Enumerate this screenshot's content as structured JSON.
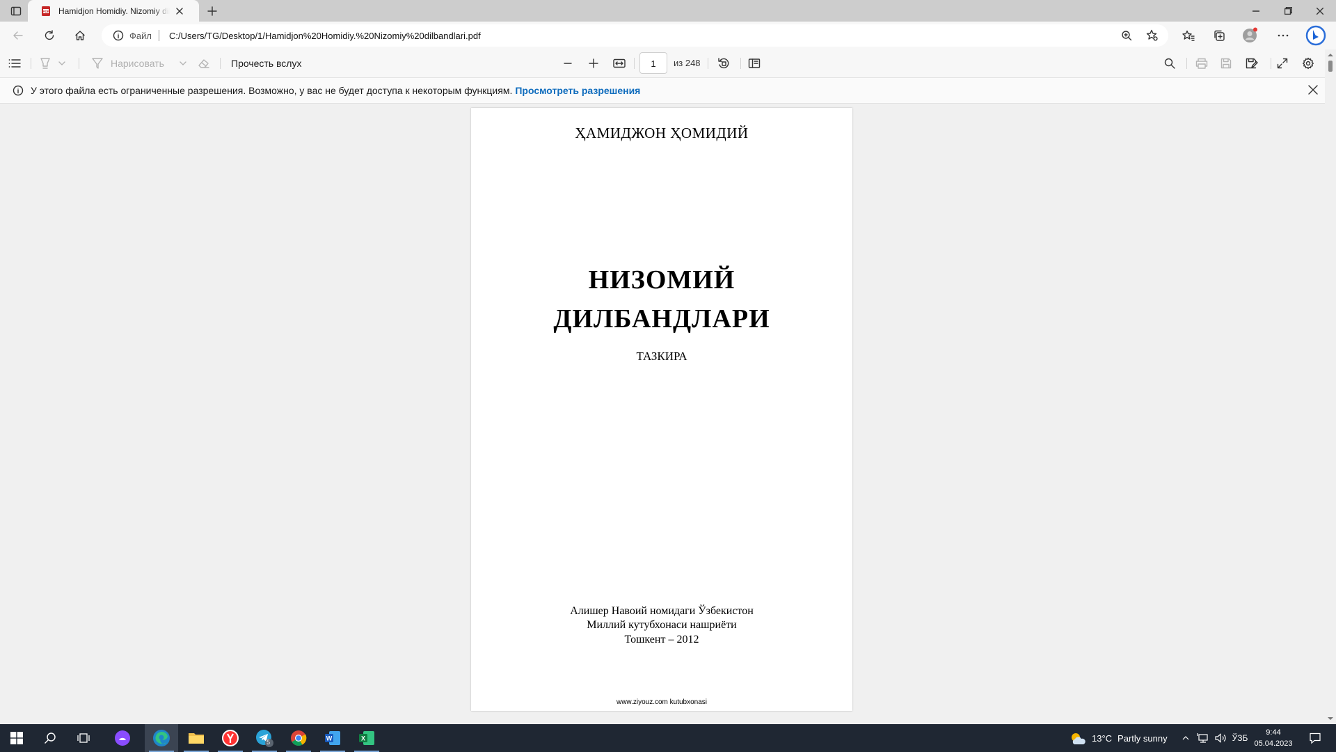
{
  "tab": {
    "title": "Hamidjon Homidiy. Nizomiy dilbandlari.pdf"
  },
  "address": {
    "scheme_label": "Файл",
    "url": "C:/Users/TG/Desktop/1/Hamidjon%20Homidiy.%20Nizomiy%20dilbandlari.pdf"
  },
  "toolbar": {
    "draw_label": "Нарисовать",
    "read_aloud_label": "Прочесть вслух",
    "page_current": "1",
    "page_total_label": "из 248"
  },
  "infobar": {
    "message": "У этого файла есть ограниченные разрешения. Возможно, у вас не будет доступа к некоторым функциям.",
    "link": "Просмотреть разрешения"
  },
  "document": {
    "author": "ҲАМИДЖОН ҲОМИДИЙ",
    "title_line1": "НИЗОМИЙ",
    "title_line2": "ДИЛБАНДЛАРИ",
    "genre": "ТАЗКИРА",
    "publisher_line1": "Алишер Навоий номидаги Ўзбекистон",
    "publisher_line2": "Миллий кутубхонаси нашриёти",
    "publisher_line3": "Тошкент – 2012",
    "footer": "www.ziyouz.com kutubxonasi"
  },
  "taskbar": {
    "weather_temp": "13°C",
    "weather_text": "Partly sunny",
    "language": "ЎЗБ",
    "time": "9:44",
    "date": "05.04.2023",
    "telegram_badge": "5"
  },
  "colors": {
    "link": "#0f6cbd",
    "taskbar": "#1f2733",
    "tabstrip": "#cdcdcd"
  }
}
